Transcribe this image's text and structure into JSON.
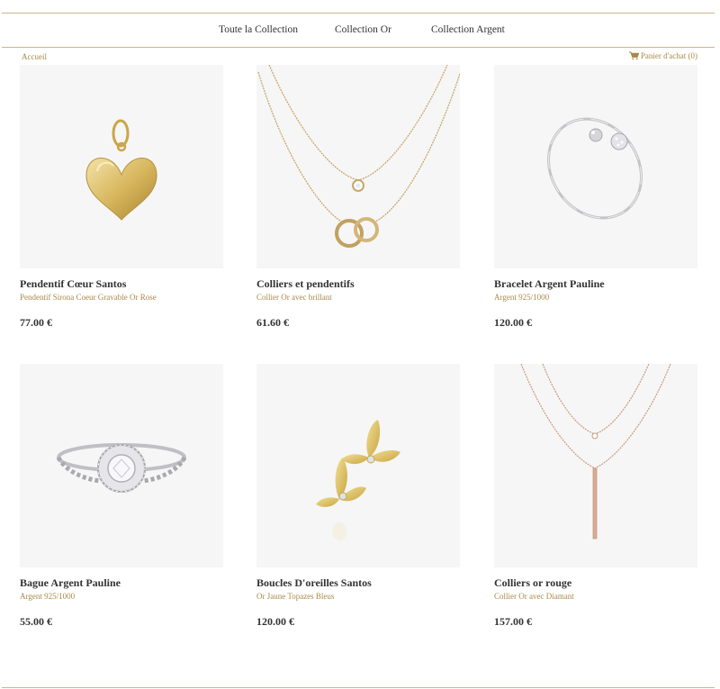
{
  "nav": {
    "items": [
      {
        "label": "Toute la Collection"
      },
      {
        "label": "Collection Or"
      },
      {
        "label": "Collection Argent"
      }
    ]
  },
  "breadcrumb": {
    "home": "Accueil"
  },
  "cart": {
    "label": "Panier d'achat (0)",
    "icon": "shopping-cart-icon"
  },
  "colors": {
    "accent": "#a9894a",
    "divider": "#c9b68e",
    "text": "#333333",
    "image_bg": "#f6f6f6"
  },
  "products": [
    {
      "name": "Pendentif Cœur Santos",
      "subtitle": "Pendentif Sirona Coeur Gravable Or Rose",
      "price": "77.00 €",
      "image": "gold-heart-locket"
    },
    {
      "name": "Colliers et pendentifs",
      "subtitle": "Collier Or avec brillant",
      "price": "61.60 €",
      "image": "gold-layered-necklace"
    },
    {
      "name": "Bracelet Argent Pauline",
      "subtitle": "Argent 925/1000",
      "price": "120.00 €",
      "image": "silver-bangle"
    },
    {
      "name": "Bague Argent Pauline",
      "subtitle": "Argent 925/1000",
      "price": "55.00 €",
      "image": "silver-halo-ring"
    },
    {
      "name": "Boucles D'oreilles Santos",
      "subtitle": "Or Jaune Topazes Bleus",
      "price": "120.00 €",
      "image": "gold-leaf-earrings"
    },
    {
      "name": "Colliers or rouge",
      "subtitle": "Collier Or avec Diamant",
      "price": "157.00 €",
      "image": "rose-gold-bar-necklace"
    }
  ]
}
